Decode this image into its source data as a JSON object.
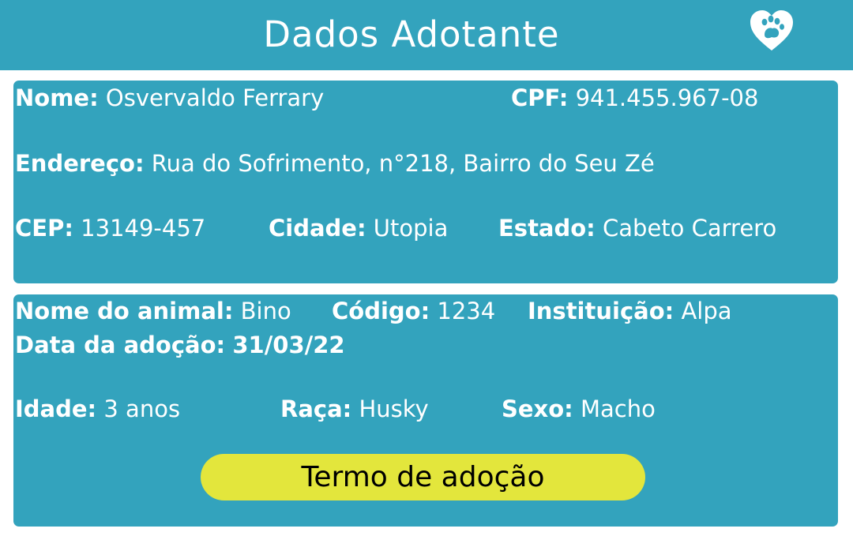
{
  "header": {
    "title": "Dados Adotante",
    "logo_icon": "heart-paw-icon"
  },
  "adopter": {
    "nome_label": "Nome:",
    "nome": "Osvervaldo Ferrary",
    "cpf_label": "CPF:",
    "cpf": "941.455.967-08",
    "endereco_label": "Endereço:",
    "endereco": "Rua do Sofrimento, n°218, Bairro do Seu Zé",
    "cep_label": "CEP:",
    "cep": "13149-457",
    "cidade_label": "Cidade:",
    "cidade": "Utopia",
    "estado_label": "Estado:",
    "estado": "Cabeto Carrero"
  },
  "animal": {
    "nome_label": "Nome do animal:",
    "nome": "Bino",
    "codigo_label": "Código:",
    "codigo": "1234",
    "instituicao_label": "Instituição:",
    "instituicao": "Alpa",
    "data_label": "Data da adoção:",
    "data": "31/03/22",
    "idade_label": "Idade:",
    "idade": "3 anos",
    "raca_label": "Raça:",
    "raca": "Husky",
    "sexo_label": "Sexo:",
    "sexo": "Macho"
  },
  "actions": {
    "termo_label": "Termo de adoção"
  },
  "colors": {
    "primary": "#33a3bd",
    "button": "#e3e63c",
    "text": "#ffffff"
  }
}
